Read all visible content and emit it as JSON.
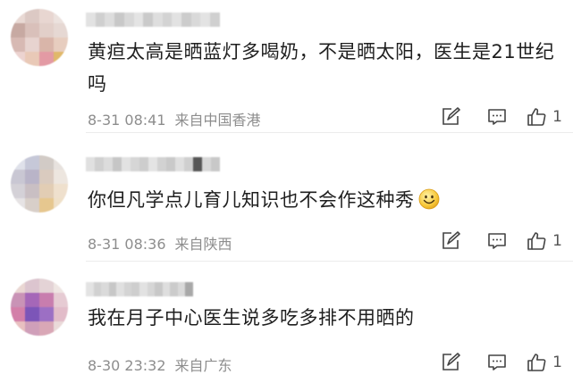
{
  "comments": [
    {
      "text": "黄疸太高是晒蓝灯多喝奶，不是晒太阳，医生是21世纪吗",
      "date": "8-31 08:41",
      "location": "来自中国香港",
      "likes": "1",
      "avatar_colors": [
        "#e9d9d4",
        "#dcc9c4",
        "#e8d6d1",
        "#ece2de",
        "#c7a9a2",
        "#d9c0ba",
        "#e2cfc9",
        "#e6d8d3",
        "#d7b9b3",
        "#e7d3cf",
        "#d9b5a9",
        "#e7cdbf",
        "#ecd3d0",
        "#e9c9b7",
        "#e39aa4",
        "#e0b86a"
      ],
      "name_colors": [
        "#e2e2e2",
        "#cfcfcf",
        "#dddddd",
        "#c8c8c8",
        "#d8d8d8",
        "#e4e4e4",
        "#cacaca",
        "#dedede",
        "#d3d3d3",
        "#e2e2e2",
        "#cccccc",
        "#d9d9d9",
        "#e3e3e3",
        "#d0d0d0"
      ]
    },
    {
      "text": "你但凡学点儿育儿知识也不会作这种秀",
      "date": "8-31 08:36",
      "location": "来自陕西",
      "likes": "1",
      "has_emoji": true,
      "avatar_colors": [
        "#dfe1ea",
        "#c6c8d8",
        "#d2cbc6",
        "#e7e2de",
        "#c9c7d3",
        "#b9b4c8",
        "#dacbbf",
        "#ede6df",
        "#d4d1d7",
        "#c9bfc3",
        "#e2cdb4",
        "#efe0cd",
        "#e6e3e4",
        "#d8cfc9",
        "#e6c78f",
        "#efe0c8"
      ],
      "name_colors": [
        "#e0e0e0",
        "#d0d0d0",
        "#dcdcdc",
        "#c6c6c6",
        "#e2e2e2",
        "#d6d6d6",
        "#cdcdcd",
        "#e4e4e4",
        "#d2d2d2",
        "#c9c9c9",
        "#dfdfdf",
        "#cfcfcf",
        "#555555",
        "#d8d8d8",
        "#c8c8c8"
      ]
    },
    {
      "text": "我在月子中心医生说多吃多排不用晒的",
      "date": "8-30 23:32",
      "location": "来自广东",
      "likes": "1",
      "avatar_colors": [
        "#ead7d3",
        "#dcc5cf",
        "#e4d3d6",
        "#efe6e3",
        "#c993b6",
        "#a567b8",
        "#c87dae",
        "#e6cbd3",
        "#d37fa9",
        "#7c55b8",
        "#9c6fc4",
        "#e2bcc9",
        "#e8c0c0",
        "#cf9fb9",
        "#d9a7b6",
        "#eadad9"
      ],
      "name_colors": [
        "#e3e3e3",
        "#d1d1d1",
        "#dadada",
        "#c7c7c7",
        "#e0e0e0",
        "#d4d4d4",
        "#cecece",
        "#e2e2e2",
        "#d6d6d6",
        "#c8c8c8",
        "#dedede",
        "#cbcbcb",
        "#d9d9d9",
        "#a8a8a8"
      ]
    }
  ],
  "icons": {
    "edit": "edit-icon",
    "comment": "comment-icon",
    "like": "thumbs-up-icon"
  },
  "colors": {
    "text": "#1f1f1f",
    "meta": "#8d8d8d",
    "icon": "#444444"
  }
}
